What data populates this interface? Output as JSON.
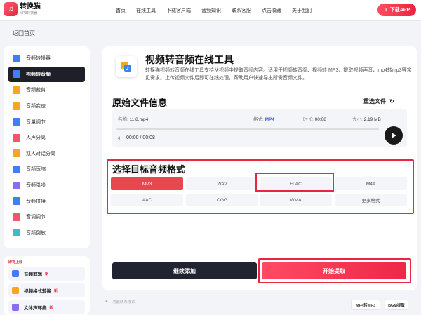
{
  "header": {
    "logo_name": "转换猫",
    "logo_sub": "MP3转换器",
    "nav": [
      "首页",
      "在线工具",
      "下载客户端",
      "音频知识",
      "联系客服",
      "点击收藏",
      "关于我们"
    ],
    "download_label": "下载APP"
  },
  "back_label": "返回首页",
  "sidebar": {
    "items": [
      {
        "label": "音频转换器",
        "color": "#3f7ff5"
      },
      {
        "label": "视频转音频",
        "color": "#3f7ff5"
      },
      {
        "label": "音频裁剪",
        "color": "#f5a623"
      },
      {
        "label": "音频变速",
        "color": "#f5a623"
      },
      {
        "label": "音量调节",
        "color": "#3f7ff5"
      },
      {
        "label": "人声分离",
        "color": "#f0556a"
      },
      {
        "label": "双人对话分离",
        "color": "#f5a623"
      },
      {
        "label": "音频压缩",
        "color": "#3f7ff5"
      },
      {
        "label": "音频降噪",
        "color": "#8b6cf0"
      },
      {
        "label": "音频拼接",
        "color": "#3f7ff5"
      },
      {
        "label": "音调调节",
        "color": "#f0556a"
      },
      {
        "label": "音频倒放",
        "color": "#2ec3c8"
      }
    ],
    "active_index": 1
  },
  "sidebar_new": {
    "title": "即将上线",
    "items": [
      {
        "label": "音频剪辑",
        "tag": "新"
      },
      {
        "label": "视频格式转换",
        "tag": "新"
      },
      {
        "label": "文体声环绕",
        "tag": "新"
      }
    ]
  },
  "tool": {
    "title": "视频转音频在线工具",
    "description": "转换猫视频转音频在线工具支持从视频中提取音频内容。适用于视频转音频、视频转 MP3、提取视频声音、mp4转mp3等常见需求。上传视频文件后即可在线处理，帮助用户快速导出所需音频文件。"
  },
  "source": {
    "section_title": "原始文件信息",
    "reselect_label": "重选文件",
    "name_label": "名称:",
    "name_value": "11.8.mp4",
    "format_label": "格式:",
    "format_value": "MP4",
    "duration_label": "时长:",
    "duration_value": "00:08",
    "size_label": "大小:",
    "size_value": "2.19 MB",
    "time_display": "00:00 / 00:08"
  },
  "target": {
    "section_title": "选择目标音频格式",
    "formats": [
      "MP3",
      "WAV",
      "FLAC",
      "M4A",
      "AAC",
      "OGG",
      "WMA",
      "更多格式"
    ],
    "selected_index": 0
  },
  "actions": {
    "continue_label": "继续添加",
    "start_label": "开始提取"
  },
  "footer": {
    "search_placeholder": "功能联系搜索",
    "chips": [
      "MP4转MP3",
      "BGM提取"
    ]
  },
  "colors": {
    "accent": "#e8263f",
    "dark": "#1f1f29",
    "format_blue": "#3a5bd9"
  }
}
